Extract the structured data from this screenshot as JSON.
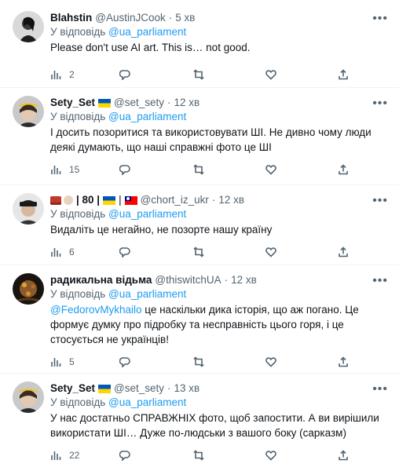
{
  "reply_prefix": "У відповідь",
  "tweets": [
    {
      "name": "Blahstin",
      "handle": "@AustinJCook",
      "time": "5 хв",
      "reply_to": "@ua_parliament",
      "text": "Please don't use AI art. This is… not good.",
      "views": "2",
      "avatar_icon": "avatar-photo"
    },
    {
      "name": "Sety_Set",
      "handle": "@set_sety",
      "time": "12 хв",
      "reply_to": "@ua_parliament",
      "text": "І досить позоритися та використовувати ШІ. Не дивно чому люди деякі думають, що наші справжні фото це ШІ",
      "views": "15",
      "avatar_icon": "avatar-photo"
    },
    {
      "name_sep": "| 80 |",
      "handle": "@chort_iz_ukr",
      "time": "12 хв",
      "reply_to": "@ua_parliament",
      "text": "Видаліть це негайно, не позорте нашу країну",
      "views": "6",
      "avatar_icon": "avatar-photo"
    },
    {
      "name": "радикальна відьма",
      "handle": "@thiswitchUA",
      "time": "12 хв",
      "reply_to": "@ua_parliament",
      "mention": "@FedorovMykhailo",
      "text": "це наскільки дика історія, що аж погано. Це формує думку про підробку та несправність цього горя, і це стосується не українців!",
      "views": "5",
      "avatar_icon": "avatar-photo"
    },
    {
      "name": "Sety_Set",
      "handle": "@set_sety",
      "time": "13 хв",
      "reply_to": "@ua_parliament",
      "text": "У нас достатньо СПРАВЖНІХ фото, щоб запостити. А ви вирішили використати ШІ… Дуже по-людськи з вашого боку (сарказм)",
      "views": "22",
      "avatar_icon": "avatar-photo"
    }
  ],
  "icons": {
    "more": "more-icon",
    "views": "views-icon",
    "reply": "reply-icon",
    "retweet": "retweet-icon",
    "like": "like-icon",
    "share": "share-icon"
  },
  "colors": {
    "link": "#1d9bf0",
    "muted": "#536471",
    "text": "#0f1419"
  }
}
